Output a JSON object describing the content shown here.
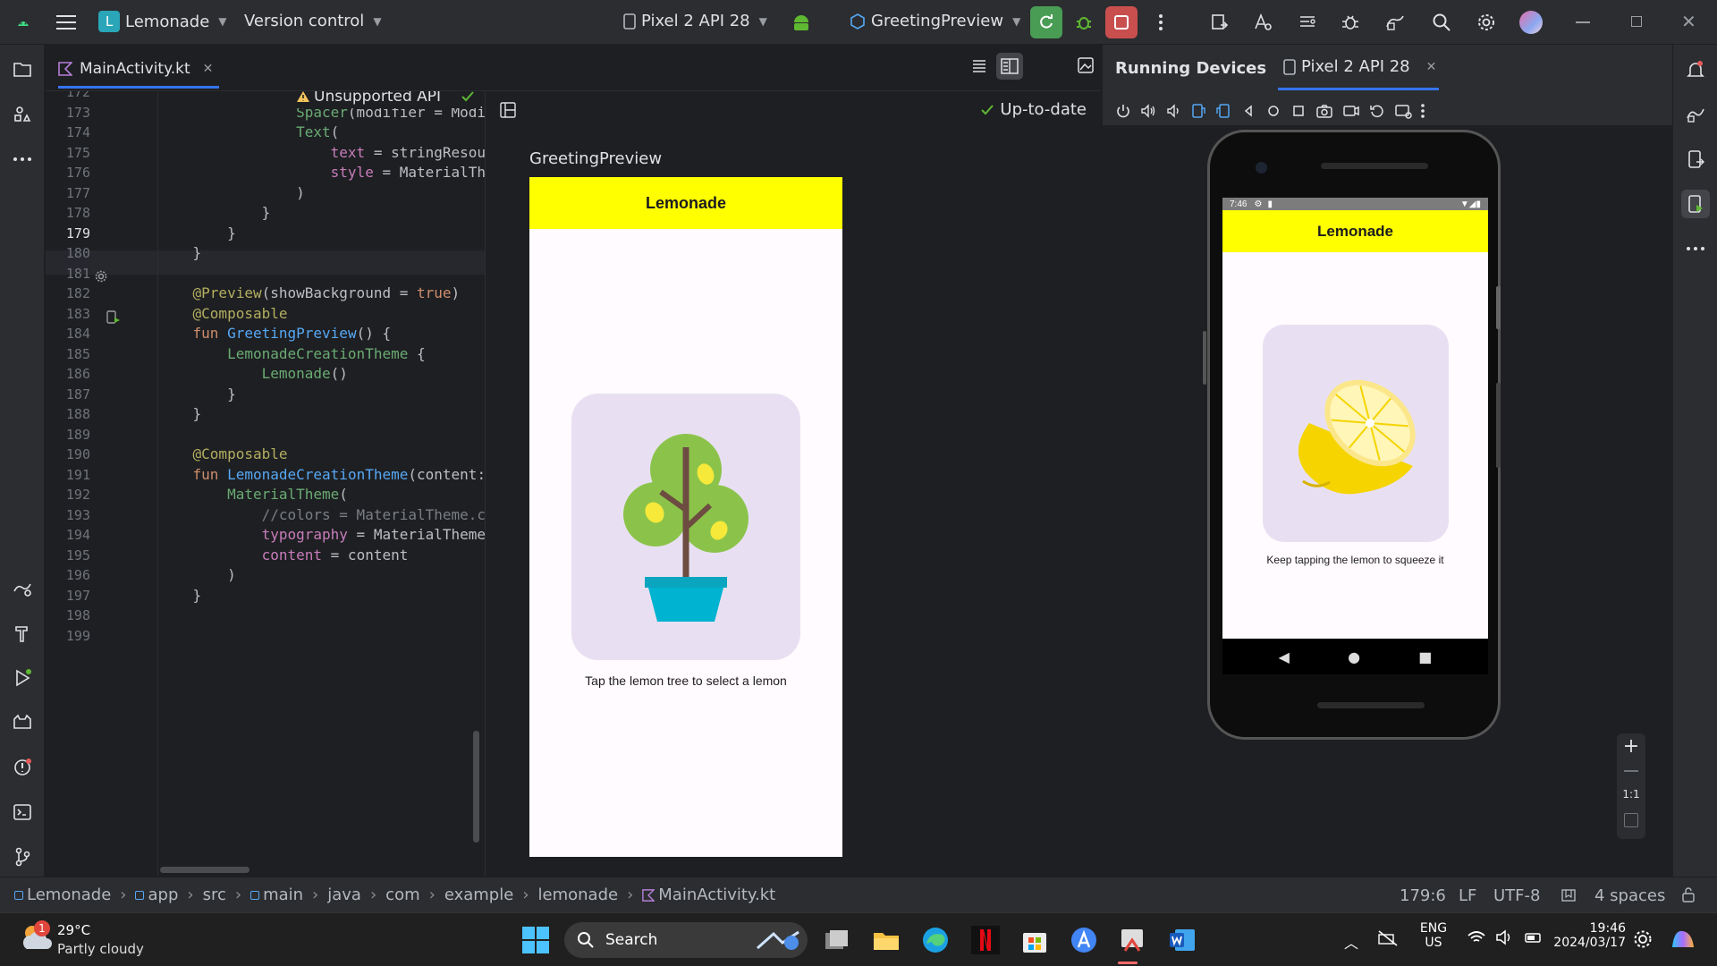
{
  "titlebar": {
    "project_letter": "L",
    "project_name": "Lemonade",
    "vcs": "Version control",
    "device": "Pixel 2 API 28",
    "run_config": "GreetingPreview"
  },
  "editor": {
    "tab_label": "MainActivity.kt",
    "warning_label": "Unsupported API",
    "lines": [
      {
        "n": "172",
        "code": "                }"
      },
      {
        "n": "173",
        "code": "                Spacer(modifier = Modifier"
      },
      {
        "n": "174",
        "code": "                Text("
      },
      {
        "n": "175",
        "code": "                    text = stringResource"
      },
      {
        "n": "176",
        "code": "                    style = MaterialTheme"
      },
      {
        "n": "177",
        "code": "                )"
      },
      {
        "n": "178",
        "code": "            }"
      },
      {
        "n": "179",
        "code": "        }"
      },
      {
        "n": "180",
        "code": "    }"
      },
      {
        "n": "181",
        "code": ""
      },
      {
        "n": "182",
        "code": "    @Preview(showBackground = true)"
      },
      {
        "n": "183",
        "code": "    @Composable"
      },
      {
        "n": "184",
        "code": "    fun GreetingPreview() {"
      },
      {
        "n": "185",
        "code": "        LemonadeCreationTheme {"
      },
      {
        "n": "186",
        "code": "            Lemonade()"
      },
      {
        "n": "187",
        "code": "        }"
      },
      {
        "n": "188",
        "code": "    }"
      },
      {
        "n": "189",
        "code": ""
      },
      {
        "n": "190",
        "code": "    @Composable"
      },
      {
        "n": "191",
        "code": "    fun LemonadeCreationTheme(content: @"
      },
      {
        "n": "192",
        "code": "        MaterialTheme("
      },
      {
        "n": "193",
        "code": "            //colors = MaterialTheme.colo"
      },
      {
        "n": "194",
        "code": "            typography = MaterialTheme.ty"
      },
      {
        "n": "195",
        "code": "            content = content"
      },
      {
        "n": "196",
        "code": "        )"
      },
      {
        "n": "197",
        "code": "    }"
      },
      {
        "n": "198",
        "code": ""
      },
      {
        "n": "199",
        "code": ""
      }
    ]
  },
  "preview": {
    "status": "Up-to-date",
    "name": "GreetingPreview",
    "app_title": "Lemonade",
    "caption": "Tap the lemon tree to select a lemon"
  },
  "devices": {
    "panel_title": "Running Devices",
    "device_tab": "Pixel 2 API 28",
    "status_time": "7:46",
    "app_title": "Lemonade",
    "caption": "Keep tapping the lemon to squeeze it",
    "zoom_reset": "1:1"
  },
  "breadcrumb": [
    "Lemonade",
    "app",
    "src",
    "main",
    "java",
    "com",
    "example",
    "lemonade",
    "MainActivity.kt"
  ],
  "status": {
    "position": "179:6",
    "line_sep": "LF",
    "encoding": "UTF-8",
    "indent": "4 spaces"
  },
  "taskbar": {
    "weather_temp": "29°C",
    "weather_desc": "Partly cloudy",
    "weather_badge": "1",
    "search": "Search",
    "lang": "ENG",
    "region": "US",
    "time": "19:46",
    "date": "2024/03/17"
  },
  "colors": {
    "app_bar": "#ffff00",
    "image_bg": "#e8e0f2",
    "accent_green": "#499c54",
    "stop_red": "#c94f4f"
  }
}
